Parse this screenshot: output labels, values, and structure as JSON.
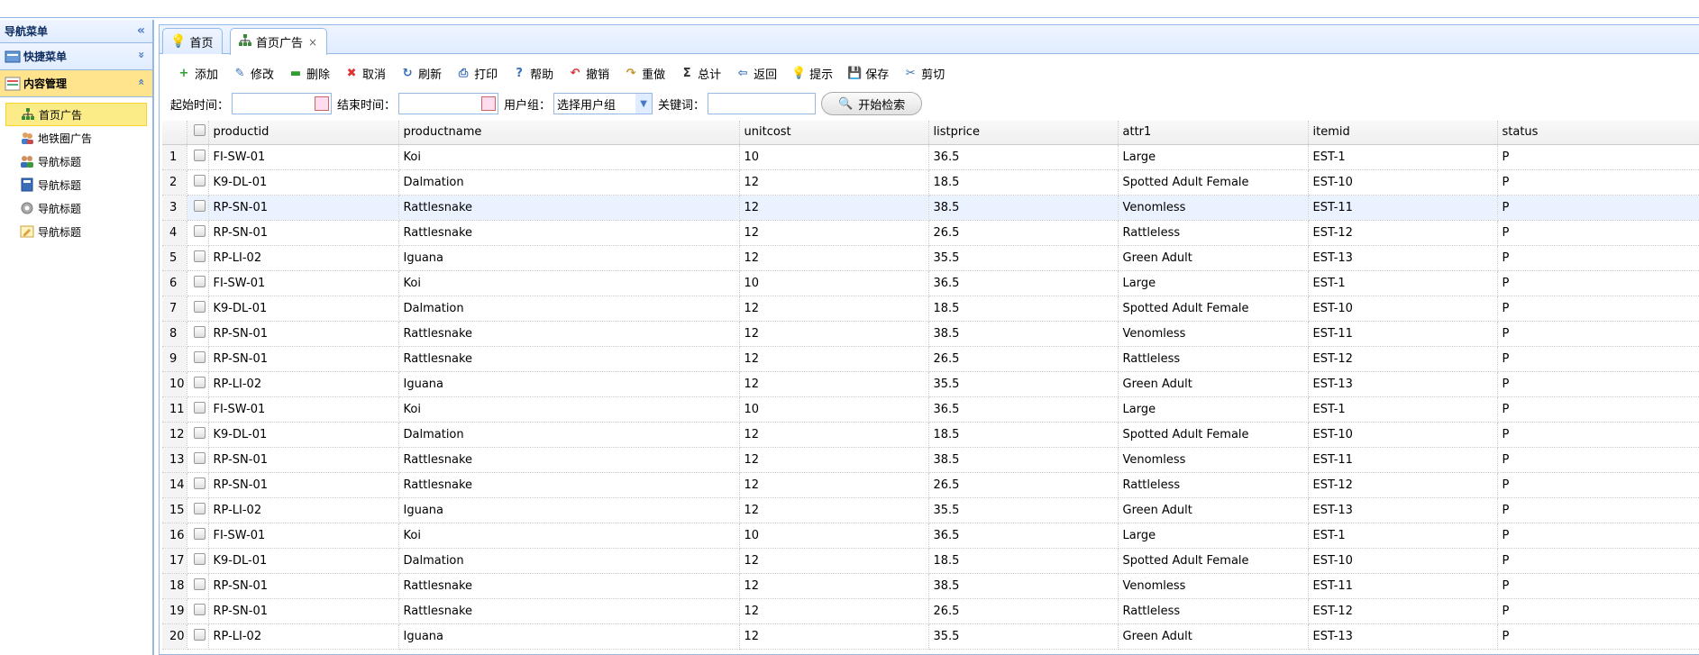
{
  "west": {
    "title": "导航菜单",
    "collapse_glyph": "«",
    "accordions": [
      {
        "label": "快捷菜单",
        "arrow": "»",
        "icon": "app-icon"
      },
      {
        "label": "内容管理",
        "arrow": "«",
        "icon": "content-icon"
      }
    ],
    "tree": [
      {
        "label": "首页广告",
        "icon": "sitemap-icon"
      },
      {
        "label": "地铁圈广告",
        "icon": "users-icon"
      },
      {
        "label": "导航标题",
        "icon": "group-icon"
      },
      {
        "label": "导航标题",
        "icon": "book-icon"
      },
      {
        "label": "导航标题",
        "icon": "gear-icon"
      },
      {
        "label": "导航标题",
        "icon": "note-icon"
      }
    ]
  },
  "tabs": [
    {
      "label": "首页",
      "icon": "lightbulb-icon"
    },
    {
      "label": "首页广告",
      "icon": "sitemap-icon",
      "close": "×"
    }
  ],
  "toolbar": [
    {
      "label": "添加",
      "icon": "add-icon",
      "glyph": "+",
      "color": "#2e9e2e"
    },
    {
      "label": "修改",
      "icon": "edit-icon",
      "glyph": "✎",
      "color": "#3a6fb8"
    },
    {
      "label": "删除",
      "icon": "remove-icon",
      "glyph": "▬",
      "color": "#2e9e2e"
    },
    {
      "label": "取消",
      "icon": "cancel-icon",
      "glyph": "✖",
      "color": "#d33"
    },
    {
      "label": "刷新",
      "icon": "reload-icon",
      "glyph": "↻",
      "color": "#3a6fb8"
    },
    {
      "label": "打印",
      "icon": "print-icon",
      "glyph": "⎙",
      "color": "#3a6fb8"
    },
    {
      "label": "帮助",
      "icon": "help-icon",
      "glyph": "?",
      "color": "#3a6fb8"
    },
    {
      "label": "撤销",
      "icon": "undo-icon",
      "glyph": "↶",
      "color": "#d33"
    },
    {
      "label": "重做",
      "icon": "redo-icon",
      "glyph": "↷",
      "color": "#c8902a"
    },
    {
      "label": "总计",
      "icon": "sum-icon",
      "glyph": "Σ",
      "color": "#333"
    },
    {
      "label": "返回",
      "icon": "back-icon",
      "glyph": "⇦",
      "color": "#3a6fb8"
    },
    {
      "label": "提示",
      "icon": "tip-icon",
      "glyph": "💡",
      "color": "#e0b000"
    },
    {
      "label": "保存",
      "icon": "save-icon",
      "glyph": "💾",
      "color": "#3a6fb8"
    },
    {
      "label": "剪切",
      "icon": "cut-icon",
      "glyph": "✂",
      "color": "#3a6fb8"
    }
  ],
  "search": {
    "start_label": "起始时间：",
    "end_label": "结束时间：",
    "group_label": "用户组：",
    "group_value": "选择用户组",
    "keyword_label": "关键词：",
    "button_label": "开始检索"
  },
  "grid": {
    "columns": [
      "productid",
      "productname",
      "unitcost",
      "listprice",
      "attr1",
      "itemid",
      "status"
    ],
    "rows": [
      [
        "1",
        "FI-SW-01",
        "Koi",
        "10",
        "36.5",
        "Large",
        "EST-1",
        "P"
      ],
      [
        "2",
        "K9-DL-01",
        "Dalmation",
        "12",
        "18.5",
        "Spotted Adult Female",
        "EST-10",
        "P"
      ],
      [
        "3",
        "RP-SN-01",
        "Rattlesnake",
        "12",
        "38.5",
        "Venomless",
        "EST-11",
        "P"
      ],
      [
        "4",
        "RP-SN-01",
        "Rattlesnake",
        "12",
        "26.5",
        "Rattleless",
        "EST-12",
        "P"
      ],
      [
        "5",
        "RP-LI-02",
        "Iguana",
        "12",
        "35.5",
        "Green Adult",
        "EST-13",
        "P"
      ],
      [
        "6",
        "FI-SW-01",
        "Koi",
        "10",
        "36.5",
        "Large",
        "EST-1",
        "P"
      ],
      [
        "7",
        "K9-DL-01",
        "Dalmation",
        "12",
        "18.5",
        "Spotted Adult Female",
        "EST-10",
        "P"
      ],
      [
        "8",
        "RP-SN-01",
        "Rattlesnake",
        "12",
        "38.5",
        "Venomless",
        "EST-11",
        "P"
      ],
      [
        "9",
        "RP-SN-01",
        "Rattlesnake",
        "12",
        "26.5",
        "Rattleless",
        "EST-12",
        "P"
      ],
      [
        "10",
        "RP-LI-02",
        "Iguana",
        "12",
        "35.5",
        "Green Adult",
        "EST-13",
        "P"
      ],
      [
        "11",
        "FI-SW-01",
        "Koi",
        "10",
        "36.5",
        "Large",
        "EST-1",
        "P"
      ],
      [
        "12",
        "K9-DL-01",
        "Dalmation",
        "12",
        "18.5",
        "Spotted Adult Female",
        "EST-10",
        "P"
      ],
      [
        "13",
        "RP-SN-01",
        "Rattlesnake",
        "12",
        "38.5",
        "Venomless",
        "EST-11",
        "P"
      ],
      [
        "14",
        "RP-SN-01",
        "Rattlesnake",
        "12",
        "26.5",
        "Rattleless",
        "EST-12",
        "P"
      ],
      [
        "15",
        "RP-LI-02",
        "Iguana",
        "12",
        "35.5",
        "Green Adult",
        "EST-13",
        "P"
      ],
      [
        "16",
        "FI-SW-01",
        "Koi",
        "10",
        "36.5",
        "Large",
        "EST-1",
        "P"
      ],
      [
        "17",
        "K9-DL-01",
        "Dalmation",
        "12",
        "18.5",
        "Spotted Adult Female",
        "EST-10",
        "P"
      ],
      [
        "18",
        "RP-SN-01",
        "Rattlesnake",
        "12",
        "38.5",
        "Venomless",
        "EST-11",
        "P"
      ],
      [
        "19",
        "RP-SN-01",
        "Rattlesnake",
        "12",
        "26.5",
        "Rattleless",
        "EST-12",
        "P"
      ],
      [
        "20",
        "RP-LI-02",
        "Iguana",
        "12",
        "35.5",
        "Green Adult",
        "EST-13",
        "P"
      ]
    ],
    "highlight_row": 3
  }
}
